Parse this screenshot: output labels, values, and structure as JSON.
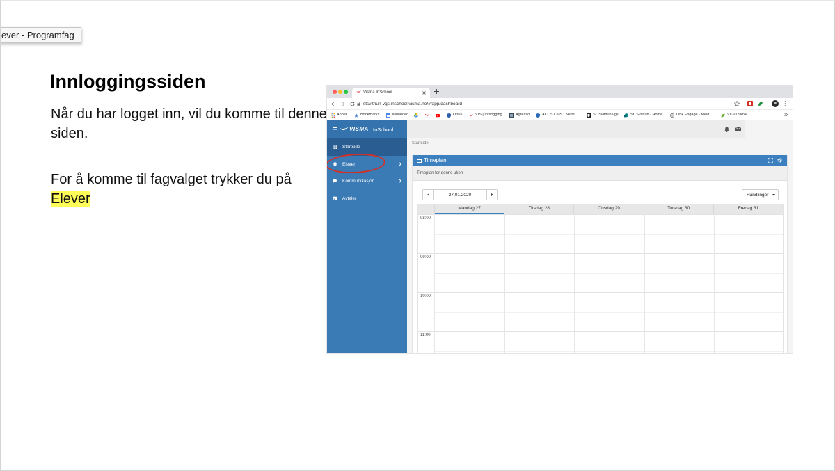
{
  "tooltip": {
    "text": "ever - Programfag"
  },
  "slide": {
    "title": "Innloggingssiden",
    "para1": "Når du har logget inn, vil du komme til denne siden.",
    "para2_prefix": "For å komme til fagvalget trykker du på",
    "para2_highlight": "Elever"
  },
  "browser": {
    "tab": {
      "title": "Visma InSchool",
      "icon": "visma-favicon-icon"
    },
    "url": "stsvithun-vgs.inschool.visma.no/#/app/dashboard",
    "bookmarks": [
      {
        "label": "Apper",
        "icon": "apps-grid-icon"
      },
      {
        "label": "Bookmarks",
        "icon": "star-icon"
      },
      {
        "label": "Kalender",
        "icon": "calendar-icon"
      },
      {
        "icon": "drive-icon"
      },
      {
        "icon": "gmail-icon"
      },
      {
        "icon": "youtube-icon"
      },
      {
        "label": "O365",
        "icon": "shield-icon"
      },
      {
        "label": "VIS | Innlogging",
        "icon": "visma-icon"
      },
      {
        "label": "Agresso",
        "icon": "agresso-icon"
      },
      {
        "label": "ACOS CMS | Nettst...",
        "icon": "shield-icon"
      },
      {
        "label": "St. Svithun vgs",
        "icon": "school-crest-icon"
      },
      {
        "label": "St. Svithun - Home",
        "icon": "sharepoint-icon"
      },
      {
        "label": "Link Engage - Meld...",
        "icon": "globe-icon"
      },
      {
        "label": "VIGO Skole",
        "icon": "leaf-icon"
      }
    ]
  },
  "app": {
    "brand": "VISMA",
    "product": "InSchool",
    "nav": [
      {
        "label": "Startside",
        "icon": "grid-icon",
        "active": true
      },
      {
        "label": "Elever",
        "icon": "graduation-cap-icon",
        "has_submenu": true
      },
      {
        "label": "Kommunikasjon",
        "icon": "chat-bubble-icon",
        "has_submenu": true
      },
      {
        "label": "Avtaler",
        "icon": "calendar-check-icon"
      }
    ],
    "breadcrumb": "Startside",
    "timetable": {
      "title": "Timeplan",
      "subtitle": "Timeplan for denne uken",
      "date": "27.01.2020",
      "actions_label": "Handlinger",
      "days": [
        "Mandag 27",
        "Tirsdag 28",
        "Onsdag 29",
        "Torsdag 30",
        "Fredag 31"
      ],
      "active_day_index": 0,
      "times": [
        "08:00",
        "09:00",
        "10:00",
        "11:00"
      ],
      "current_time_marker": 8.8
    }
  },
  "theme": {
    "sidebar": "#3a7ab5",
    "sidebar_header": "#3473ad",
    "sidebar_active": "#2a5e92",
    "panel_header": "#3d80c0",
    "highlight": "#ffff57",
    "annotation": "#d22f27",
    "now_line": "#d9534f",
    "tab_bar": "#dfe1e5"
  }
}
